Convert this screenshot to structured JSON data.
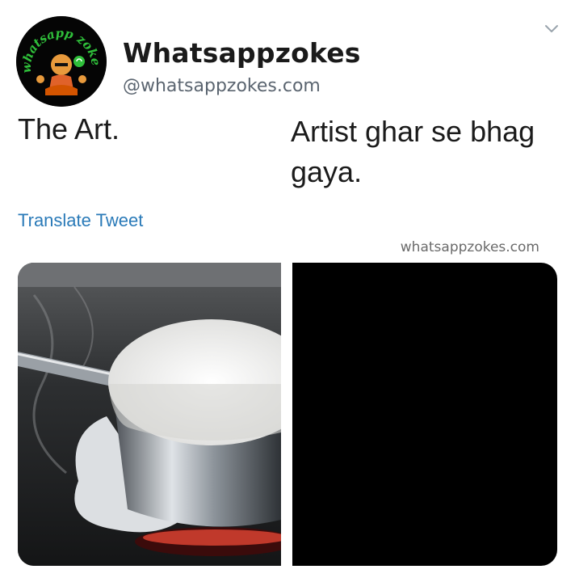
{
  "header": {
    "display_name": "Whatsappzokes",
    "handle": "@whatsappzokes.com",
    "avatar_text": "whatsapp zokes",
    "menu_icon": "chevron-down-icon"
  },
  "tweet": {
    "caption_left": "The Art.",
    "caption_right": "Artist ghar se bhag gaya.",
    "translate_label": "Translate Tweet"
  },
  "watermark": "whatsappzokes.com",
  "media": {
    "left_image": "milk-boiling-over-pan",
    "right_image": "black-frame"
  },
  "colors": {
    "link": "#2a7ab8",
    "avatar_ring_text": "#2fbf3a",
    "right_panel": "#000000"
  }
}
